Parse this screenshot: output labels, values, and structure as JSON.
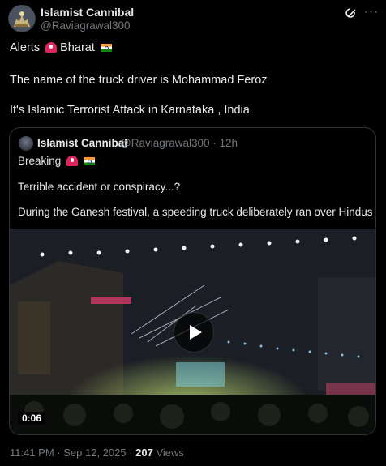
{
  "post": {
    "display_name": "Islamist Cannibal",
    "handle": "@Raviagrawal300",
    "line1": "Alerts",
    "line1b": "Bharat",
    "line2": "The name of the truck driver is Mohammad Feroz",
    "line3": "It's Islamic Terrorist Attack in Karnataka , India",
    "timestamp": "11:41 PM · Sep 12, 2025 · ",
    "views_count": "207",
    "views_label": " Views"
  },
  "quoted": {
    "display_name": "Islamist Cannibal",
    "handle_time": "@Raviagrawal300 · 12h",
    "line1": "Breaking",
    "line2": "Terrible accident or conspiracy...?",
    "line3": "During the Ganesh festival, a speeding truck deliberately ran over Hindus wh...",
    "video_duration": "0:06"
  },
  "icons": [
    "avatar",
    "grok-icon",
    "more-icon",
    "siren-emoji-icon",
    "india-flag-icon",
    "play-icon"
  ],
  "colors": {
    "background": "#000000",
    "text": "#e7e9ea",
    "muted": "#71767b",
    "border": "#2f3336"
  }
}
